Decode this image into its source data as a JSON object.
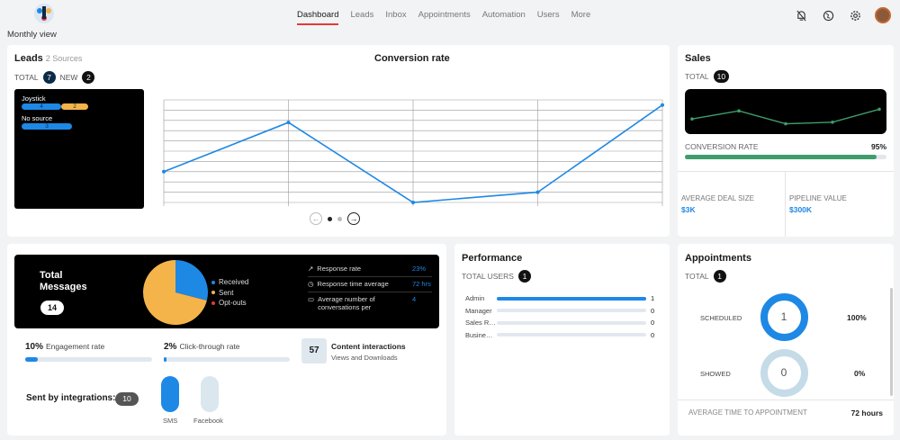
{
  "header": {
    "caption": "Monthly view",
    "tabs": [
      {
        "label": "Dashboard",
        "active": true
      },
      {
        "label": "Leads"
      },
      {
        "label": "Inbox"
      },
      {
        "label": "Appointments"
      },
      {
        "label": "Automation"
      },
      {
        "label": "Users"
      },
      {
        "label": "More"
      }
    ],
    "icons": [
      "bell-off-icon",
      "globe-icon",
      "gear-icon",
      "avatar"
    ],
    "accent": "#e53935"
  },
  "leads": {
    "title": "Leads",
    "sources_text": "2 Sources",
    "total_label": "TOTAL",
    "total_value": "7",
    "new_label": "NEW",
    "new_value": "2",
    "sources": [
      {
        "name": "Joystick",
        "segments": [
          {
            "value": "4",
            "color": "#1e88e5"
          },
          {
            "value": "2",
            "color": "#f5b44a"
          }
        ]
      },
      {
        "name": "No source",
        "segments": [
          {
            "value": "3",
            "color": "#1e88e5"
          }
        ]
      }
    ]
  },
  "chart_data": {
    "type": "line",
    "title": "Conversion rate",
    "values": [
      0.3,
      0.78,
      0.0,
      0.1,
      0.95
    ],
    "ylim": [
      0,
      1
    ],
    "grid": true,
    "color": "#1e88e5"
  },
  "sales": {
    "title": "Sales",
    "total_label": "TOTAL",
    "total_value": "10",
    "spark": [
      0.3,
      0.55,
      0.15,
      0.2,
      0.6
    ],
    "conversion_label": "CONVERSION RATE",
    "conversion_value": "95%",
    "conversion_fraction": 0.95,
    "avg_deal_label": "AVERAGE DEAL SIZE",
    "avg_deal_value": "$3K",
    "pipeline_label": "PIPELINE VALUE",
    "pipeline_value": "$300K"
  },
  "messages": {
    "title": "Total Messages",
    "total": "14",
    "pie": [
      {
        "label": "Received",
        "fraction": 0.29,
        "color": "#1e88e5"
      },
      {
        "label": "Sent",
        "fraction": 0.71,
        "color": "#f5b44a"
      },
      {
        "label": "Opt-outs",
        "fraction": 0.0,
        "color": "#e53935"
      }
    ],
    "stats": [
      {
        "icon": "trend-up-icon",
        "label": "Response rate",
        "value": "23%"
      },
      {
        "icon": "clock-icon",
        "label": "Response time average",
        "value": "72 hrs"
      },
      {
        "icon": "chat-icon",
        "label": "Average number of conversations per",
        "value": "4"
      }
    ],
    "engagement_pct": "10%",
    "engagement_label": "Engagement rate",
    "engagement_fraction": 0.1,
    "ctr_pct": "2%",
    "ctr_label": "Click-through rate",
    "ctr_fraction": 0.02,
    "content_count": "57",
    "content_title": "Content interactions",
    "content_sub": "Views and Downloads",
    "integrations_label": "Sent by integrations:",
    "integrations_count": "10",
    "integrations": [
      {
        "label": "SMS",
        "fraction": 1.0
      },
      {
        "label": "Facebook",
        "fraction": 0.0
      }
    ]
  },
  "performance": {
    "title": "Performance",
    "total_label": "TOTAL USERS",
    "total_value": "1",
    "rows": [
      {
        "name": "Admin",
        "count": "1",
        "fraction": 1.0
      },
      {
        "name": "Manager",
        "count": "0",
        "fraction": 0.0
      },
      {
        "name": "Sales R…",
        "count": "0",
        "fraction": 0.0
      },
      {
        "name": "Busine…",
        "count": "0",
        "fraction": 0.0
      }
    ]
  },
  "appointments": {
    "title": "Appointments",
    "total_label": "TOTAL",
    "total_value": "1",
    "scheduled_label": "SCHEDULED",
    "scheduled_count": "1",
    "scheduled_pct": "100%",
    "showed_label": "SHOWED",
    "showed_count": "0",
    "showed_pct": "0%",
    "avg_time_label": "AVERAGE TIME TO APPOINTMENT",
    "avg_time_value": "72 hours",
    "ring_color": "#1e88e5",
    "ring_empty_color": "#c5dbe8"
  }
}
